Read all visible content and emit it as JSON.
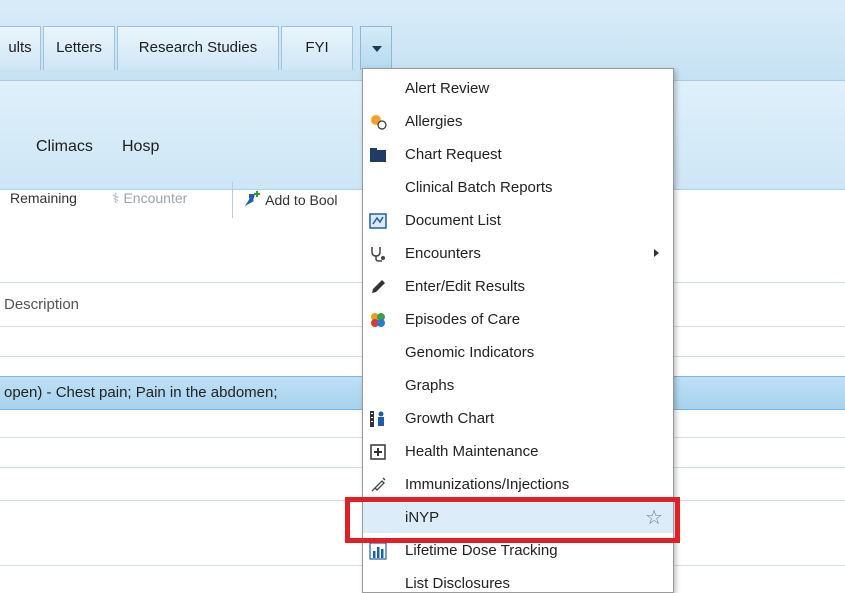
{
  "tabs": [
    {
      "label": "ults"
    },
    {
      "label": "Letters"
    },
    {
      "label": "Research Studies"
    },
    {
      "label": "FYI"
    }
  ],
  "subtabs": [
    "Climacs",
    "Hosp"
  ],
  "toolbar": {
    "remaining": "Remaining",
    "encounter": "Encounter",
    "add_to_book": "Add to Bool"
  },
  "table": {
    "header": "Description",
    "selected_row": "open) - Chest pain; Pain in the abdomen;"
  },
  "menu": {
    "items": [
      {
        "label": "Alert Review",
        "icon": "none"
      },
      {
        "label": "Allergies",
        "icon": "allergies-icon"
      },
      {
        "label": "Chart Request",
        "icon": "folder-icon"
      },
      {
        "label": "Clinical Batch Reports",
        "icon": "none"
      },
      {
        "label": "Document List",
        "icon": "document-list-icon"
      },
      {
        "label": "Encounters",
        "icon": "stethoscope-icon",
        "submenu": true
      },
      {
        "label": "Enter/Edit Results",
        "icon": "pencil-icon"
      },
      {
        "label": "Episodes of Care",
        "icon": "episodes-icon"
      },
      {
        "label": "Genomic Indicators",
        "icon": "none"
      },
      {
        "label": "Graphs",
        "icon": "none"
      },
      {
        "label": "Growth Chart",
        "icon": "growth-chart-icon"
      },
      {
        "label": "Health Maintenance",
        "icon": "health-maintenance-icon"
      },
      {
        "label": "Immunizations/Injections",
        "icon": "syringe-icon"
      },
      {
        "label": "iNYP",
        "icon": "none",
        "highlighted": true
      },
      {
        "label": "Lifetime Dose Tracking",
        "icon": "bar-chart-icon"
      },
      {
        "label": "List Disclosures",
        "icon": "none"
      }
    ]
  },
  "colors": {
    "highlight_box": "#e01f26",
    "accent_blue": "#a7d2ee"
  }
}
